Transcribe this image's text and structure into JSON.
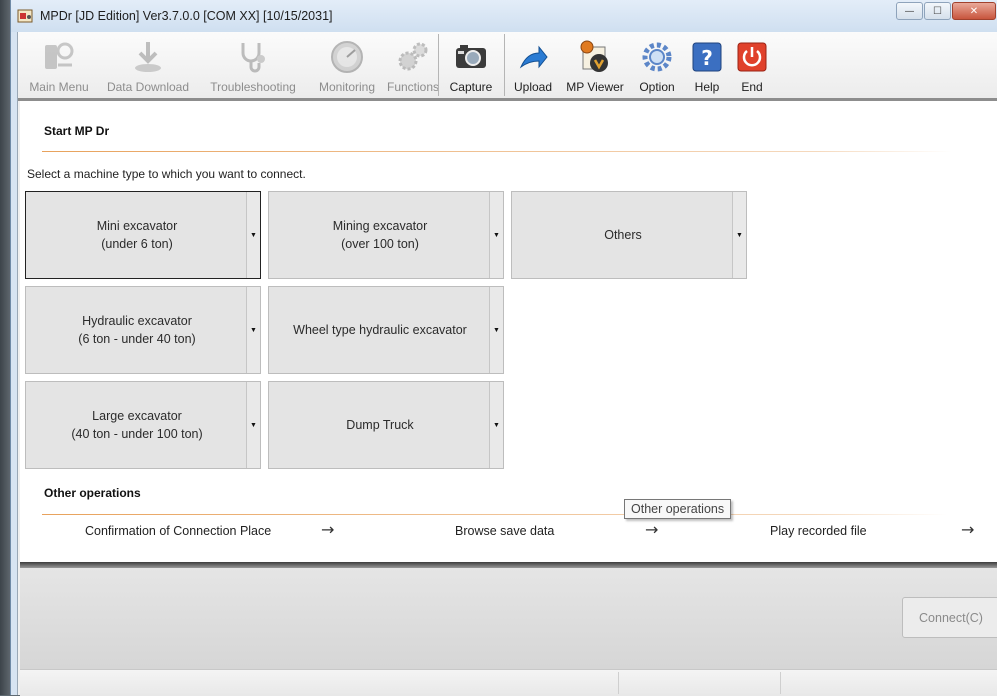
{
  "window": {
    "title": "MPDr [JD Edition] Ver3.7.0.0 [COM XX] [10/15/2031]",
    "buttons": {
      "minimize": "—",
      "maximize": "☐",
      "close": "✕"
    }
  },
  "toolbar": {
    "items": [
      {
        "label": "Main Menu",
        "icon": "main-menu-icon",
        "enabled": false
      },
      {
        "label": "Data Download",
        "icon": "data-download-icon",
        "enabled": false
      },
      {
        "label": "Troubleshooting",
        "icon": "stethoscope-icon",
        "enabled": false
      },
      {
        "label": "Monitoring",
        "icon": "gauge-icon",
        "enabled": false
      },
      {
        "label": "Functions",
        "icon": "gears-icon",
        "enabled": false
      },
      {
        "label": "Capture",
        "icon": "camera-icon",
        "enabled": true
      },
      {
        "label": "Upload",
        "icon": "upload-arrow-icon",
        "enabled": true
      },
      {
        "label": "MP Viewer",
        "icon": "mp-viewer-icon",
        "enabled": true
      },
      {
        "label": "Option",
        "icon": "option-gear-icon",
        "enabled": true
      },
      {
        "label": "Help",
        "icon": "help-icon",
        "enabled": true
      },
      {
        "label": "End",
        "icon": "power-icon",
        "enabled": true
      }
    ]
  },
  "start": {
    "title": "Start MP Dr",
    "instruction": "Select a machine type to which you want to connect."
  },
  "machines": [
    {
      "line1": "Mini excavator",
      "line2": "(under 6 ton)",
      "selected": true
    },
    {
      "line1": "Mining excavator",
      "line2": "(over 100 ton)",
      "selected": false
    },
    {
      "line1": "Others",
      "line2": "",
      "selected": false
    },
    {
      "line1": "Hydraulic excavator",
      "line2": "(6 ton - under 40 ton)",
      "selected": false
    },
    {
      "line1": "Wheel type hydraulic excavator",
      "line2": "",
      "selected": false
    },
    {
      "line1": "Large excavator",
      "line2": "(40 ton - under 100 ton)",
      "selected": false
    },
    {
      "line1": "Dump Truck",
      "line2": "",
      "selected": false
    }
  ],
  "dropdown_glyph": "▼",
  "other_ops": {
    "title": "Other operations",
    "items": [
      {
        "label": "Confirmation of Connection Place",
        "arrow": "→"
      },
      {
        "label": "Browse save data",
        "arrow": "→"
      },
      {
        "label": "Play recorded file",
        "arrow": "→"
      }
    ],
    "tooltip": "Other operations"
  },
  "footer": {
    "connect_label": "Connect(C)"
  },
  "colors": {
    "accent_line": "#e8a25c",
    "button_face": "#e4e4e4"
  }
}
